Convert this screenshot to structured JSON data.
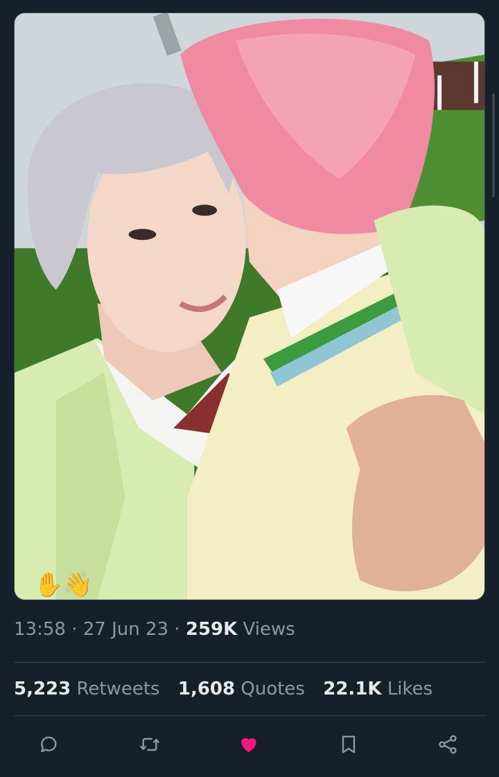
{
  "tweet": {
    "media": {
      "emoji": "✋👋",
      "accent_colors": {
        "pink_hair": "#f08aa3",
        "silver_hair": "#c9c7cf",
        "jacket": "#d8ebb0",
        "sweater": "#f4efc2",
        "grass": "#3f7a2a"
      }
    },
    "meta": {
      "time": "13:58",
      "separator": " · ",
      "date": "27 Jun 23",
      "views_count": "259K",
      "views_label": "Views"
    },
    "stats": [
      {
        "count": "5,223",
        "label": "Retweets"
      },
      {
        "count": "1,608",
        "label": "Quotes"
      },
      {
        "count": "22.1K",
        "label": "Likes"
      }
    ],
    "actions": [
      {
        "icon": "reply-icon"
      },
      {
        "icon": "retweet-icon"
      },
      {
        "icon": "heart-icon",
        "active": true,
        "color": "#f91880"
      },
      {
        "icon": "bookmark-icon"
      },
      {
        "icon": "share-icon"
      }
    ]
  }
}
